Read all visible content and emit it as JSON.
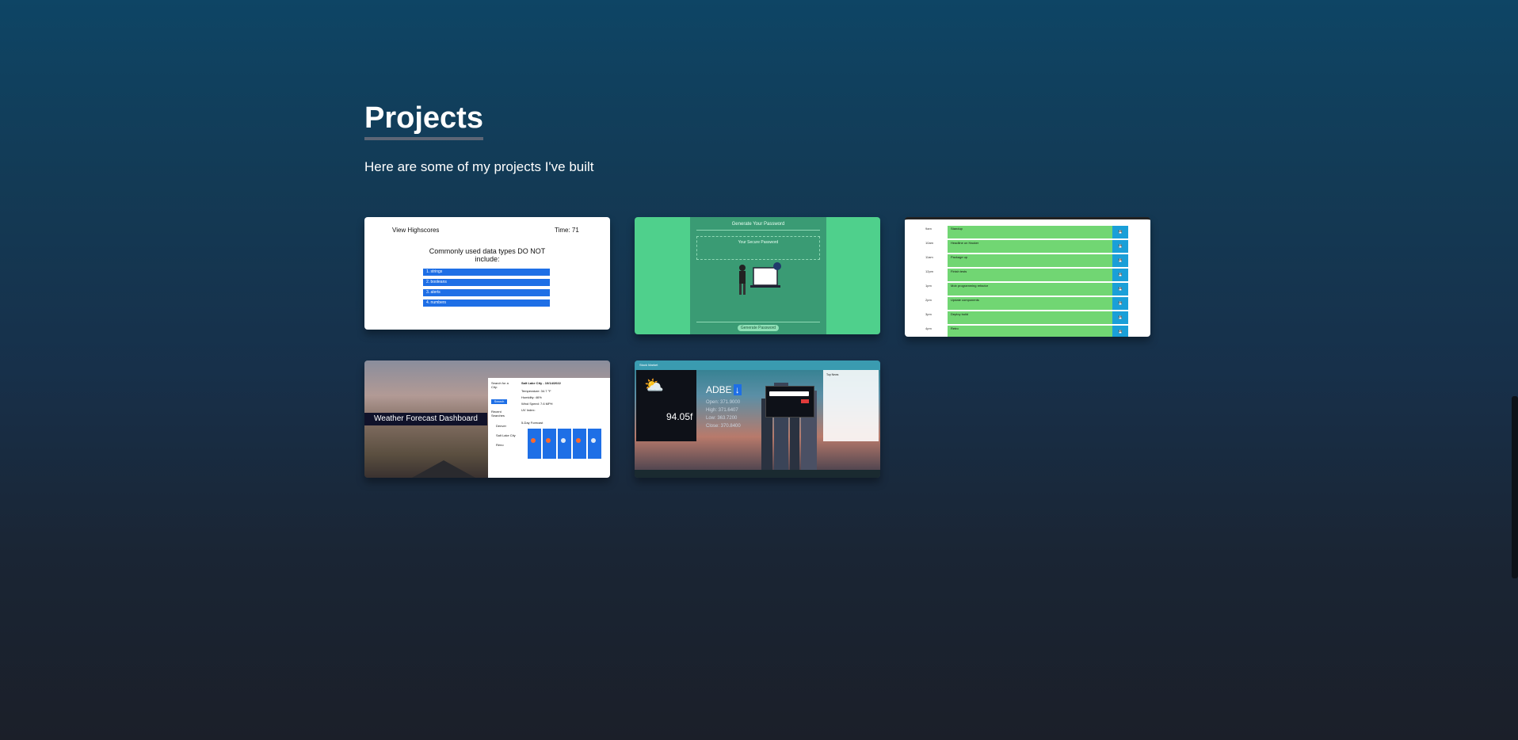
{
  "section": {
    "title": "Projects",
    "subtitle": "Here are some of my projects I've built"
  },
  "projects": [
    {
      "id": "quiz",
      "header_left": "View Highscores",
      "header_right": "Time: 71",
      "question": "Commonly used data types DO NOT include:",
      "options": [
        "1. strings",
        "2. booleans",
        "3. alerts",
        "4. numbers"
      ]
    },
    {
      "id": "password",
      "title": "Generate Your Password",
      "placeholder": "Your Secure Password",
      "button": "Generate Password"
    },
    {
      "id": "scheduler",
      "hours": [
        "9am",
        "10am",
        "11am",
        "12pm",
        "1pm",
        "2pm",
        "3pm",
        "4pm",
        "5pm"
      ],
      "events": [
        "Standup",
        "Headline on Hacker",
        "Package up",
        "Finish tests",
        "Mob programming refactor",
        "Update components",
        "Deploy build",
        "Retro",
        "Check inbox"
      ],
      "save_label": "💾"
    },
    {
      "id": "weather",
      "banner": "Weather Forecast Dashboard",
      "search_label": "Search for a City:",
      "search_button": "Search",
      "recent_label": "Recent Searches",
      "recent": [
        "Denver",
        "Salt Lake City",
        "Reno"
      ],
      "city": "Salt Lake City - 10/14/2022",
      "temp": "Temperature: 34.7 °F",
      "humidity": "Humidity: 46%",
      "wind": "Wind Speed: 7.6 MPH",
      "uv": "UV Index:",
      "forecast_label": "5-Day Forecast"
    },
    {
      "id": "stocks",
      "top": "Stock Market",
      "temp": "94.05f",
      "ticker": "ADBE",
      "ticker_badge": "↓",
      "open": "Open: 371.9000",
      "high": "High: 371.6407",
      "low": "Low: 363.7200",
      "close": "Close: 370.8400",
      "search_hint": "Enter a symbol",
      "news": "Top News"
    }
  ]
}
